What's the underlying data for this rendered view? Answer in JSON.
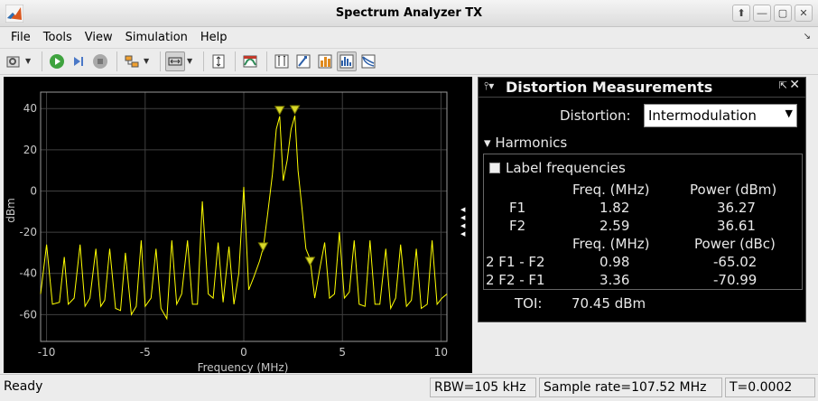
{
  "window": {
    "title": "Spectrum Analyzer TX",
    "app_icon": "matlab-logo-icon"
  },
  "window_buttons": [
    "restore-up-icon",
    "close-up-icon",
    "maximize-icon",
    "close-icon"
  ],
  "menu": [
    "File",
    "Tools",
    "View",
    "Simulation",
    "Help"
  ],
  "toolbar_icons": [
    "settings-icon",
    "run-icon",
    "step-forward-icon",
    "stop-icon",
    "signal-selector-icon",
    "zoom-icon",
    "autoscale-icon",
    "channel-measurements-icon",
    "data-cursor-icon",
    "peak-finder-icon",
    "cursor-measurements-icon",
    "distortion-measurements-icon",
    "ccdf-icon"
  ],
  "plot": {
    "ylabel": "dBm",
    "xlabel": "Frequency (MHz)",
    "yticks": [
      "40",
      "20",
      "0",
      "-20",
      "-40",
      "-60"
    ],
    "xticks": [
      "-10",
      "-5",
      "0",
      "5",
      "10"
    ],
    "colors": {
      "trace": "#ffff00",
      "grid": "#404040",
      "axis": "#9a9a9a",
      "background": "#000000"
    }
  },
  "chart_data": {
    "type": "line",
    "xlabel": "Frequency (MHz)",
    "ylabel": "dBm",
    "xlim": [
      -10.3,
      10.3
    ],
    "ylim": [
      -73,
      48
    ],
    "grid": true,
    "series": [
      {
        "x": [
          -10.3,
          -10.0,
          -9.7,
          -9.35,
          -9.1,
          -8.9,
          -8.6,
          -8.3,
          -8.05,
          -7.8,
          -7.5,
          -7.25,
          -7.05,
          -6.8,
          -6.5,
          -6.25,
          -6.0,
          -5.7,
          -5.45,
          -5.2,
          -5.0,
          -4.7,
          -4.45,
          -4.2,
          -3.9,
          -3.65,
          -3.4,
          -3.15,
          -2.85,
          -2.6,
          -2.35,
          -2.1,
          -1.8,
          -1.55,
          -1.3,
          -1.05,
          -0.75,
          -0.5,
          -0.25,
          0.0,
          0.25,
          0.5,
          0.8,
          1.0,
          1.2,
          1.45,
          1.65,
          1.82,
          2.0,
          2.2,
          2.4,
          2.59,
          2.75,
          2.95,
          3.15,
          3.36,
          3.6,
          3.85,
          4.1,
          4.35,
          4.6,
          4.85,
          5.1,
          5.35,
          5.6,
          5.85,
          6.15,
          6.4,
          6.65,
          6.9,
          7.2,
          7.45,
          7.7,
          7.95,
          8.25,
          8.5,
          8.75,
          9.0,
          9.3,
          9.55,
          9.8,
          10.05,
          10.3
        ],
        "values": [
          -50,
          -26,
          -55,
          -54,
          -32,
          -55,
          -52,
          -26,
          -56,
          -52,
          -28,
          -56,
          -53,
          -28,
          -57,
          -58,
          -30,
          -60,
          -56,
          -24,
          -56,
          -52,
          -28,
          -57,
          -62,
          -24,
          -55,
          -50,
          -24,
          -55,
          -55,
          -5,
          -50,
          -52,
          -25,
          -54,
          -27,
          -55,
          -40,
          2,
          -48,
          -42,
          -34,
          -27,
          -12,
          8,
          30,
          36.27,
          5,
          15,
          30,
          36.61,
          10,
          -8,
          -28,
          -33,
          -52,
          -38,
          -25,
          -52,
          -50,
          -20,
          -52,
          -49,
          -24,
          -55,
          -56,
          -24,
          -55,
          -55,
          -28,
          -57,
          -52,
          -26,
          -56,
          -53,
          -28,
          -57,
          -55,
          -24,
          -55,
          -52,
          -50
        ]
      }
    ],
    "markers": [
      {
        "x": 1.82,
        "y": 36.27
      },
      {
        "x": 2.59,
        "y": 36.61
      },
      {
        "x": 0.98,
        "y": -30
      },
      {
        "x": 3.36,
        "y": -37
      }
    ]
  },
  "measurements": {
    "title": "Distortion Measurements",
    "distortion_label": "Distortion:",
    "distortion_value": "Intermodulation",
    "harmonics_label": "Harmonics",
    "label_frequencies": "Label frequencies",
    "freq_header_1": "Freq. (MHz)",
    "power_header_1": "Power (dBm)",
    "rows_1": [
      {
        "name": "F1",
        "freq": "1.82",
        "power": "36.27"
      },
      {
        "name": "F2",
        "freq": "2.59",
        "power": "36.61"
      }
    ],
    "freq_header_2": "Freq. (MHz)",
    "power_header_2": "Power (dBc)",
    "rows_2": [
      {
        "name": "2 F1 - F2",
        "freq": "0.98",
        "power": "-65.02"
      },
      {
        "name": "2 F2 - F1",
        "freq": "3.36",
        "power": "-70.99"
      }
    ],
    "toi_label": "TOI:",
    "toi_value": "70.45 dBm"
  },
  "status": {
    "ready": "Ready",
    "rbw": "RBW=105 kHz",
    "sample_rate": "Sample rate=107.52 MHz",
    "time": "T=0.0002"
  }
}
